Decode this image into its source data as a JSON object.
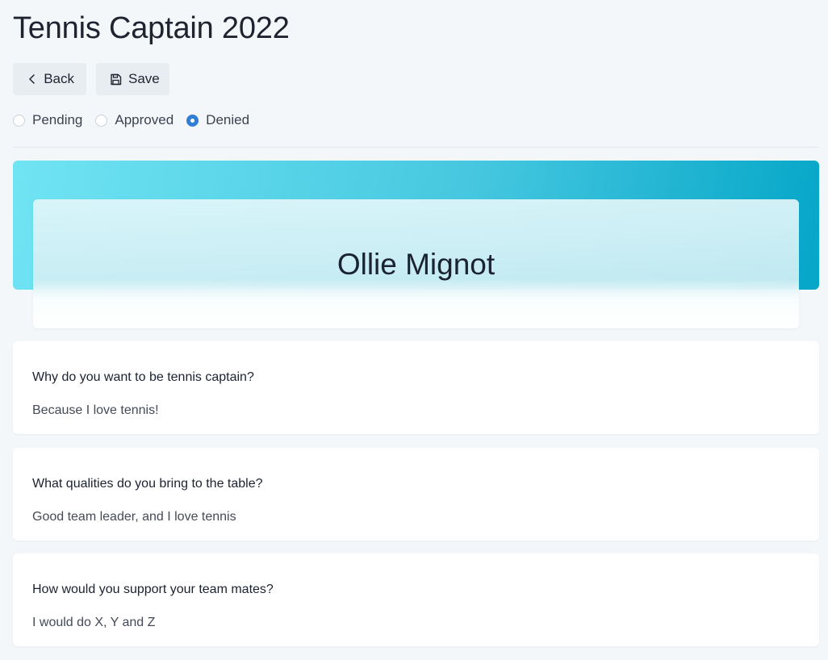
{
  "page": {
    "title": "Tennis Captain 2022"
  },
  "toolbar": {
    "back_label": "Back",
    "back_icon": "chevron-left-icon",
    "save_label": "Save",
    "save_icon": "floppy-disk-icon"
  },
  "status": {
    "options": [
      {
        "label": "Pending",
        "selected": false
      },
      {
        "label": "Approved",
        "selected": false
      },
      {
        "label": "Denied",
        "selected": true
      }
    ],
    "selected_color": "#2f7dd4"
  },
  "applicant": {
    "name": "Ollie Mignot",
    "banner_colors": [
      "#70e4f3",
      "#05a6c8"
    ]
  },
  "questions": [
    {
      "question": "Why do you want to be tennis captain?",
      "answer": "Because I love tennis!"
    },
    {
      "question": "What qualities do you bring to the table?",
      "answer": "Good team leader, and I love tennis"
    },
    {
      "question": "How would you support your team mates?",
      "answer": "I would do X, Y and Z"
    }
  ]
}
